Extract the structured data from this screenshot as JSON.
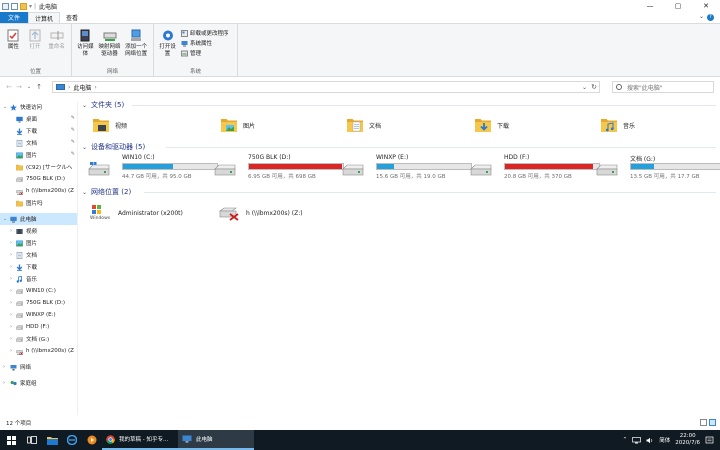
{
  "window": {
    "title": "此电脑",
    "controls": {
      "minimize": "—",
      "maximize": "▢",
      "close": "✕"
    }
  },
  "ribbon_tabs": [
    "文件",
    "计算机",
    "查看"
  ],
  "ribbon": {
    "groups": [
      {
        "label": "位置",
        "buttons": [
          "属性",
          "打开",
          "重命名"
        ]
      },
      {
        "label": "网络",
        "buttons": [
          "访问媒体",
          "映射网络驱动器",
          "添加一个网络位置"
        ]
      },
      {
        "label": "系统",
        "buttons": [
          "打开设置"
        ],
        "small": [
          "卸载或更改程序",
          "系统属性",
          "管理"
        ]
      }
    ]
  },
  "address": {
    "path": "此电脑",
    "search_placeholder": "搜索\"此电脑\""
  },
  "sidebar": {
    "quick_access": "快速访问",
    "quick_items": [
      {
        "label": "桌面",
        "icon": "desktop-icon",
        "pinned": true
      },
      {
        "label": "下载",
        "icon": "download-icon",
        "pinned": true
      },
      {
        "label": "文档",
        "icon": "document-icon",
        "pinned": true
      },
      {
        "label": "图片",
        "icon": "picture-icon",
        "pinned": true
      },
      {
        "label": "(C92) [サークルへ",
        "icon": "folder-icon",
        "pinned": false
      },
      {
        "label": "750G BLK (D:)",
        "icon": "drive-icon",
        "pinned": false
      },
      {
        "label": "h (\\\\lbmx200s) (Z",
        "icon": "network-drive-icon",
        "pinned": false
      },
      {
        "label": "图片吗",
        "icon": "folder-icon",
        "pinned": false
      }
    ],
    "this_pc": "此电脑",
    "pc_items": [
      {
        "label": "视频",
        "icon": "video-icon"
      },
      {
        "label": "图片",
        "icon": "picture-icon"
      },
      {
        "label": "文档",
        "icon": "document-icon"
      },
      {
        "label": "下载",
        "icon": "download-icon"
      },
      {
        "label": "音乐",
        "icon": "music-icon"
      },
      {
        "label": "WIN10 (C:)",
        "icon": "drive-icon"
      },
      {
        "label": "750G BLK (D:)",
        "icon": "drive-icon"
      },
      {
        "label": "WINXP (E:)",
        "icon": "drive-icon"
      },
      {
        "label": "HDD (F:)",
        "icon": "drive-icon"
      },
      {
        "label": "文档 (G:)",
        "icon": "drive-icon"
      },
      {
        "label": "h (\\\\lbmx200s) (Z",
        "icon": "network-drive-icon"
      }
    ],
    "network": "网络",
    "homegroup": "家庭组"
  },
  "content": {
    "folders_header": "文件夹 (5)",
    "folders": [
      {
        "label": "视频",
        "icon": "video-folder-icon"
      },
      {
        "label": "图片",
        "icon": "picture-folder-icon"
      },
      {
        "label": "文档",
        "icon": "document-folder-icon"
      },
      {
        "label": "下载",
        "icon": "download-folder-icon"
      },
      {
        "label": "音乐",
        "icon": "music-folder-icon"
      }
    ],
    "drives_header": "设备和驱动器 (5)",
    "drives": [
      {
        "name": "WIN10 (C:)",
        "size": "44.7 GB 可用，共 95.0 GB",
        "used_fraction": 0.53,
        "color": "#26a0da",
        "system": true
      },
      {
        "name": "750G BLK (D:)",
        "size": "6.95 GB 可用，共 698 GB",
        "used_fraction": 0.99,
        "color": "#da2626",
        "system": false
      },
      {
        "name": "WINXP (E:)",
        "size": "15.6 GB 可用，共 19.0 GB",
        "used_fraction": 0.18,
        "color": "#26a0da",
        "system": false
      },
      {
        "name": "HDD (F:)",
        "size": "20.8 GB 可用，共 370 GB",
        "used_fraction": 0.94,
        "color": "#da2626",
        "system": false
      },
      {
        "name": "文档 (G:)",
        "size": "13.5 GB 可用，共 17.7 GB",
        "used_fraction": 0.24,
        "color": "#26a0da",
        "system": false
      }
    ],
    "network_header": "网络位置 (2)",
    "network": [
      {
        "label": "Administrator (x200t)",
        "icon": "windows-media-icon"
      },
      {
        "label": "h (\\\\lbmx200s) (Z:)",
        "icon": "disconnected-network-drive-icon"
      }
    ]
  },
  "status": {
    "count": "12 个项目"
  },
  "taskbar": {
    "apps": [
      {
        "label": "我的草稿 - 知乎专...",
        "icon": "chrome-icon",
        "active": false
      },
      {
        "label": "此电脑",
        "icon": "explorer-icon",
        "active": true
      }
    ],
    "lang": "简体",
    "time": "22:00",
    "date": "2020/7/6"
  }
}
